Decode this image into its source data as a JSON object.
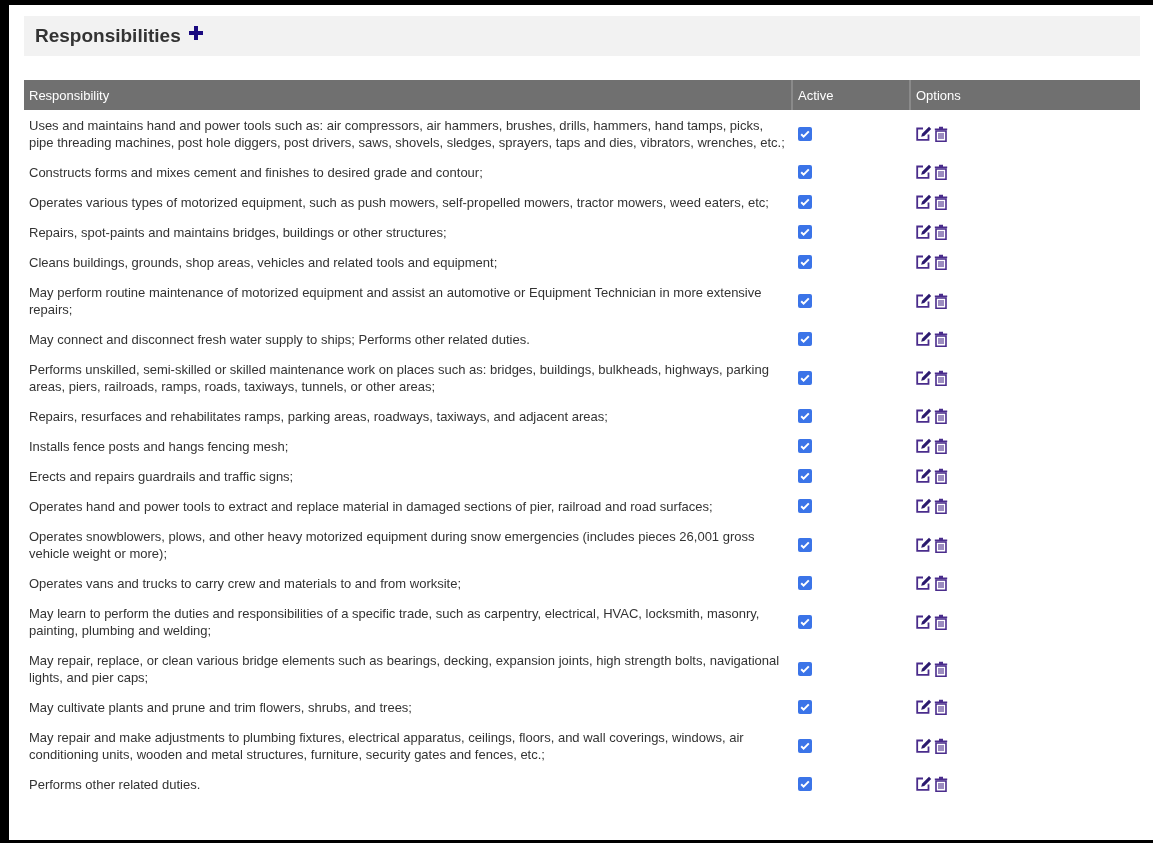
{
  "section": {
    "title": "Responsibilities"
  },
  "table": {
    "columns": [
      "Responsibility",
      "Active",
      "Options"
    ],
    "rows": [
      {
        "text": "Uses and maintains hand and power tools such as: air compressors, air hammers, brushes, drills, hammers, hand tamps, picks, pipe threading machines, post hole diggers, post drivers, saws, shovels, sledges, sprayers, taps and dies, vibrators, wrenches, etc.;",
        "active": true
      },
      {
        "text": "Constructs forms and mixes cement and finishes to desired grade and contour;",
        "active": true
      },
      {
        "text": "Operates various types of motorized equipment, such as push mowers, self-propelled mowers, tractor mowers, weed eaters, etc;",
        "active": true
      },
      {
        "text": "Repairs, spot-paints and maintains bridges, buildings or other structures;",
        "active": true
      },
      {
        "text": "Cleans buildings, grounds, shop areas, vehicles and related tools and equipment;",
        "active": true
      },
      {
        "text": "May perform routine maintenance of motorized equipment and assist an automotive or Equipment Technician in more extensive repairs;",
        "active": true
      },
      {
        "text": "May connect and disconnect fresh water supply to ships; Performs other related duties.",
        "active": true
      },
      {
        "text": "Performs unskilled, semi-skilled or skilled maintenance work on places such as: bridges, buildings, bulkheads, highways, parking areas, piers, railroads, ramps, roads, taxiways, tunnels, or other areas;",
        "active": true
      },
      {
        "text": "Repairs, resurfaces and rehabilitates ramps, parking areas, roadways, taxiways, and adjacent areas;",
        "active": true
      },
      {
        "text": "Installs fence posts and hangs fencing mesh;",
        "active": true
      },
      {
        "text": "Erects and repairs guardrails and traffic signs;",
        "active": true
      },
      {
        "text": "Operates hand and power tools to extract and replace material in damaged sections of pier, railroad and road surfaces;",
        "active": true
      },
      {
        "text": "Operates snowblowers, plows, and other heavy motorized equipment during snow emergencies (includes pieces 26,001 gross vehicle weight or more);",
        "active": true
      },
      {
        "text": "Operates vans and trucks to carry crew and materials to and from worksite;",
        "active": true
      },
      {
        "text": "May learn to perform the duties and responsibilities of a specific trade, such as carpentry, electrical, HVAC, locksmith, masonry, painting, plumbing and welding;",
        "active": true
      },
      {
        "text": "May repair, replace, or clean various bridge elements such as bearings, decking, expansion joints, high strength bolts, navigational lights, and pier caps;",
        "active": true
      },
      {
        "text": "May cultivate plants and prune and trim flowers, shrubs, and trees;",
        "active": true
      },
      {
        "text": "May repair and make adjustments to plumbing fixtures, electrical apparatus, ceilings, floors, and wall coverings, windows, air conditioning units, wooden and metal structures, furniture, security gates and fences, etc.;",
        "active": true
      },
      {
        "text": "Performs other related duties.",
        "active": true
      }
    ]
  }
}
